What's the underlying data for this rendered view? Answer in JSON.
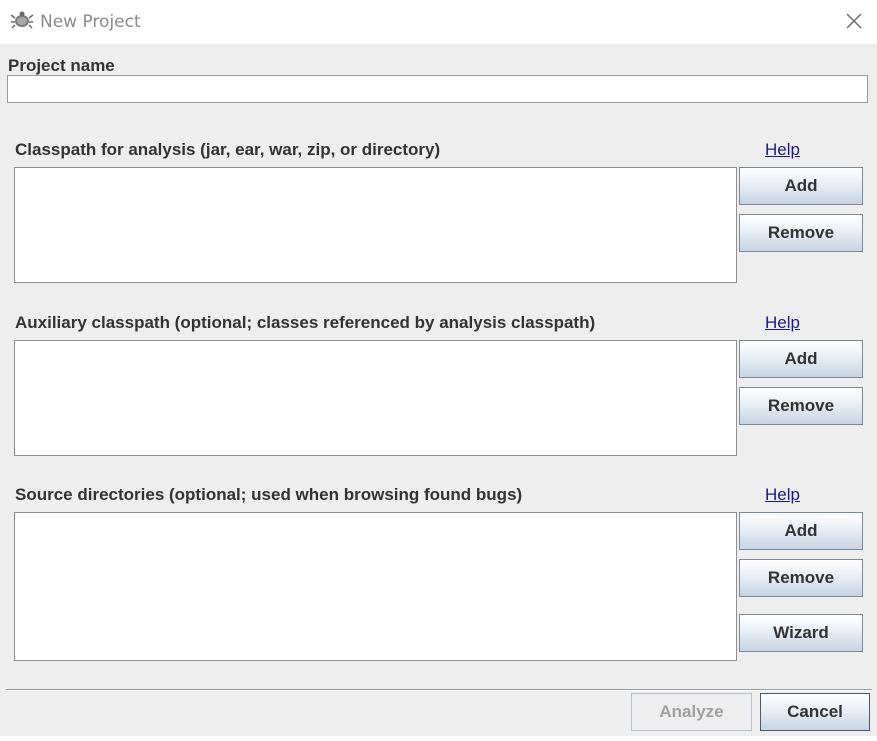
{
  "window": {
    "title": "New Project",
    "icon": "bug-icon",
    "close_icon": "close-icon"
  },
  "project_name": {
    "label": "Project name",
    "value": "",
    "placeholder": ""
  },
  "classpath": {
    "label": "Classpath for analysis (jar, ear, war, zip, or directory)",
    "help": "Help",
    "items": [],
    "add_label": "Add",
    "remove_label": "Remove"
  },
  "auxiliary": {
    "label": "Auxiliary classpath (optional; classes referenced by analysis classpath)",
    "help": "Help",
    "items": [],
    "add_label": "Add",
    "remove_label": "Remove"
  },
  "source": {
    "label": "Source directories (optional; used when browsing found bugs)",
    "help": "Help",
    "items": [],
    "add_label": "Add",
    "remove_label": "Remove",
    "wizard_label": "Wizard"
  },
  "footer": {
    "analyze_label": "Analyze",
    "analyze_enabled": false,
    "cancel_label": "Cancel"
  },
  "colors": {
    "link": "#1a1a8c",
    "label_text": "#333333",
    "disabled_text": "#a0a0a0"
  }
}
